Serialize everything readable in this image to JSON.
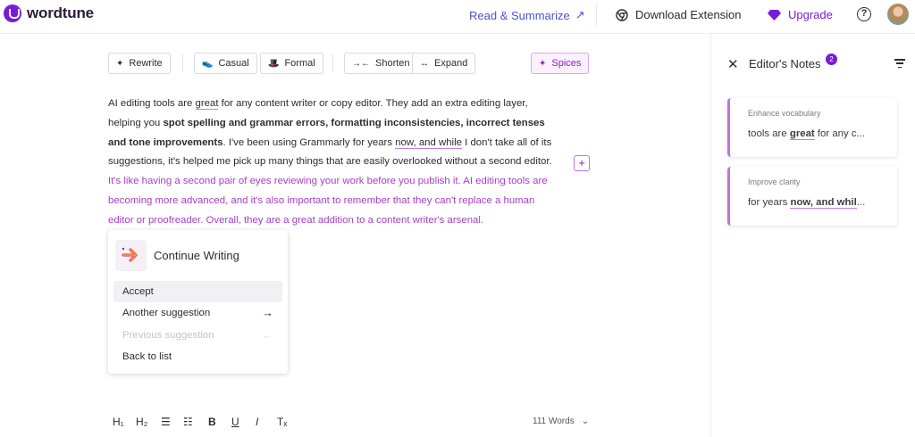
{
  "app": {
    "name": "wordtune"
  },
  "header": {
    "read_summarize": "Read & Summarize",
    "download_extension": "Download Extension",
    "upgrade": "Upgrade",
    "help": "?"
  },
  "toolbar": {
    "rewrite": "Rewrite",
    "casual": "Casual",
    "formal": "Formal",
    "shorten": "Shorten",
    "expand": "Expand",
    "spices": "Spices"
  },
  "editor": {
    "p1": "AI editing tools are ",
    "u1": "great",
    "p2": " for any content writer or copy editor. They add an extra editing layer, helping you ",
    "b1": "spot spelling and grammar errors, formatting inconsistencies, incorrect tenses and tone improvements",
    "p3": ". I've been using Grammarly for years ",
    "u2": "now, and while",
    "p4": " I don't take all of its suggestions, it's helped me pick up many things that are easily overlooked without a second editor.",
    "suggestion": "It's like having a second pair of eyes reviewing your work before you publish it. AI editing tools are becoming more advanced, and it's also important to remember that they can't replace a human editor or proofreader. Overall, they are a great addition to a content writer's arsenal."
  },
  "popup": {
    "title": "Continue Writing",
    "items": [
      "Accept",
      "Another suggestion",
      "Previous suggestion",
      "Back to list"
    ]
  },
  "format_bar": {
    "h1": "H₁",
    "h2": "H₂",
    "bold": "B",
    "underline": "U",
    "italic": "I",
    "clear": "Tₓ",
    "word_count": "111 Words"
  },
  "panel": {
    "title": "Editor's Notes",
    "badge": "2",
    "cards": [
      {
        "tag": "Enhance vocabulary",
        "pre": "tools are ",
        "hl": "great",
        "post": " for any c..."
      },
      {
        "tag": "Improve clarity",
        "pre": "for years ",
        "hl": "now, and whil",
        "post": "..."
      }
    ]
  },
  "colors": {
    "brand": "#7a1bd6",
    "suggestion": "#a63ec9",
    "link": "#4a52d8"
  }
}
